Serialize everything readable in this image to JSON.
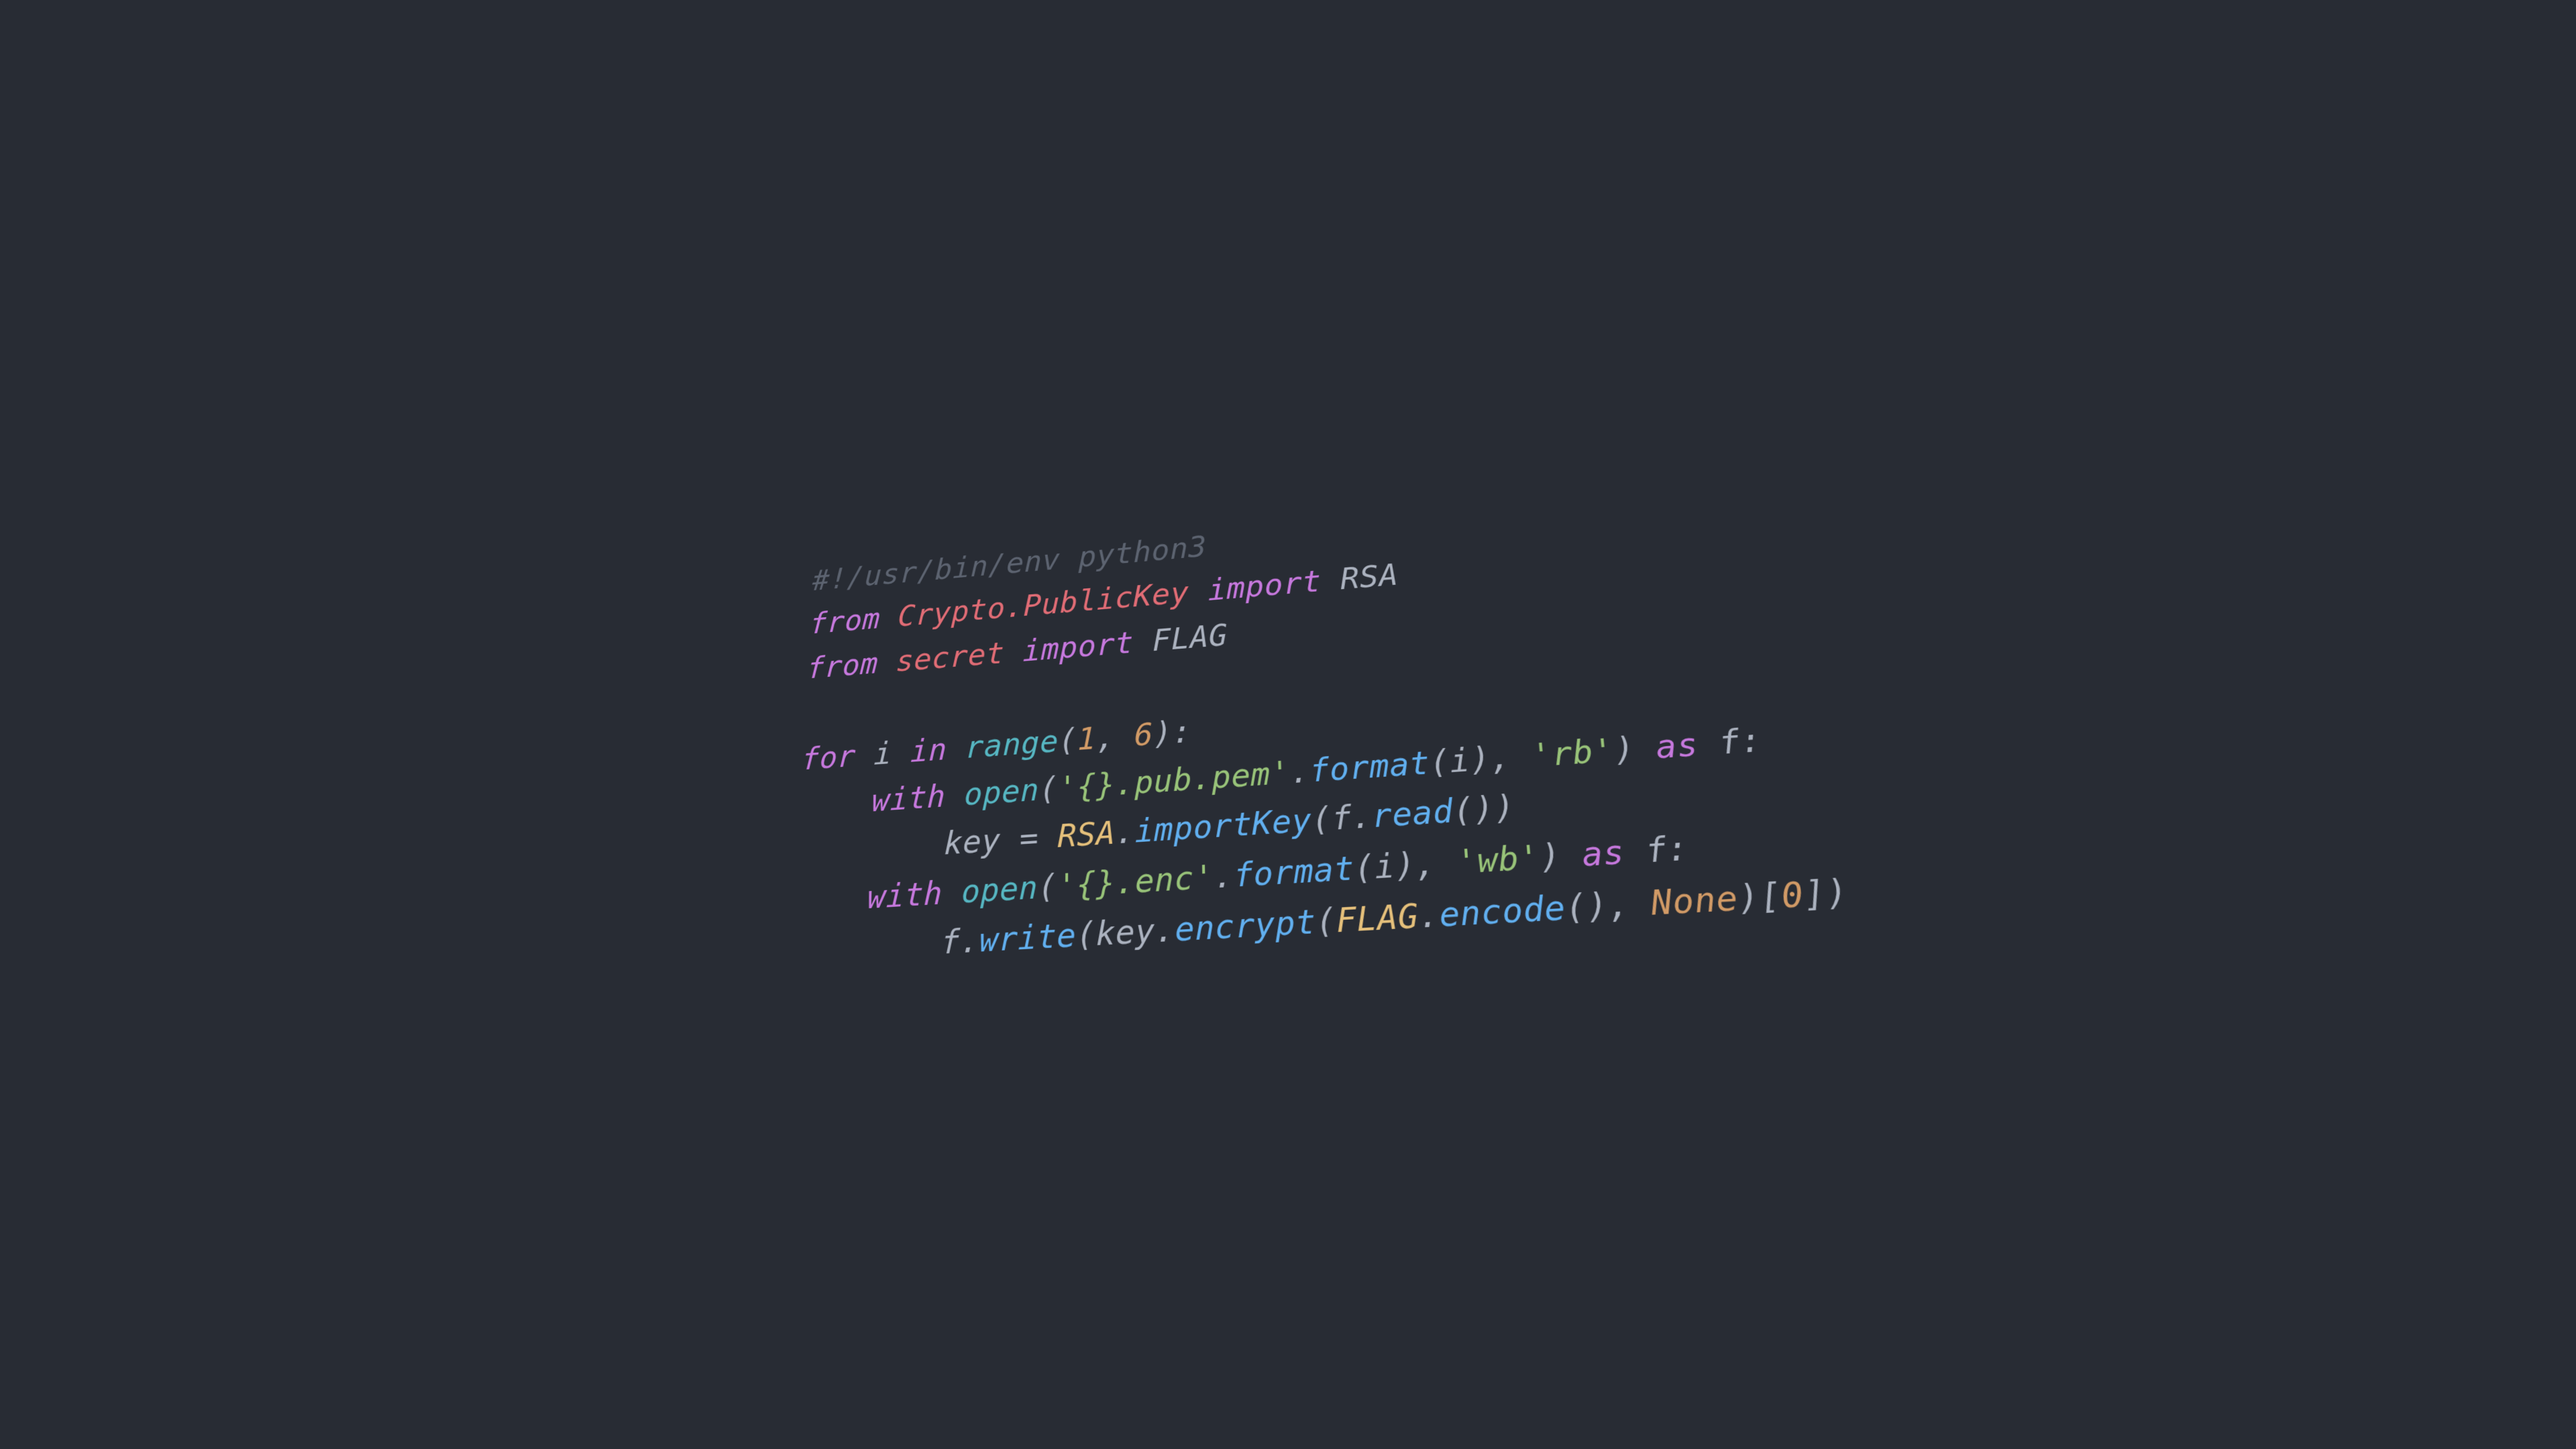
{
  "code": {
    "lines": [
      {
        "indent": 0,
        "tokens": [
          {
            "cls": "tok-comment",
            "text": "#!/usr/bin/env python3"
          }
        ]
      },
      {
        "indent": 0,
        "tokens": [
          {
            "cls": "tok-keyword",
            "text": "from"
          },
          {
            "cls": "tok-ident",
            "text": " "
          },
          {
            "cls": "tok-module",
            "text": "Crypto.PublicKey"
          },
          {
            "cls": "tok-ident",
            "text": " "
          },
          {
            "cls": "tok-keyword",
            "text": "import"
          },
          {
            "cls": "tok-ident",
            "text": " "
          },
          {
            "cls": "tok-ident",
            "text": "RSA"
          }
        ]
      },
      {
        "indent": 0,
        "tokens": [
          {
            "cls": "tok-keyword",
            "text": "from"
          },
          {
            "cls": "tok-ident",
            "text": " "
          },
          {
            "cls": "tok-module",
            "text": "secret"
          },
          {
            "cls": "tok-ident",
            "text": " "
          },
          {
            "cls": "tok-keyword",
            "text": "import"
          },
          {
            "cls": "tok-ident",
            "text": " "
          },
          {
            "cls": "tok-ident",
            "text": "FLAG"
          }
        ]
      },
      {
        "indent": 0,
        "tokens": []
      },
      {
        "indent": 0,
        "tokens": [
          {
            "cls": "tok-keyword",
            "text": "for"
          },
          {
            "cls": "tok-ident",
            "text": " i "
          },
          {
            "cls": "tok-keyword",
            "text": "in"
          },
          {
            "cls": "tok-ident",
            "text": " "
          },
          {
            "cls": "tok-builtin",
            "text": "range"
          },
          {
            "cls": "tok-punct",
            "text": "("
          },
          {
            "cls": "tok-num",
            "text": "1"
          },
          {
            "cls": "tok-punct",
            "text": ", "
          },
          {
            "cls": "tok-num",
            "text": "6"
          },
          {
            "cls": "tok-punct",
            "text": "):"
          }
        ]
      },
      {
        "indent": 1,
        "tokens": [
          {
            "cls": "tok-keyword",
            "text": "with"
          },
          {
            "cls": "tok-ident",
            "text": " "
          },
          {
            "cls": "tok-builtin",
            "text": "open"
          },
          {
            "cls": "tok-punct",
            "text": "("
          },
          {
            "cls": "tok-str",
            "text": "'{}.pub.pem'"
          },
          {
            "cls": "tok-punct",
            "text": "."
          },
          {
            "cls": "tok-func",
            "text": "format"
          },
          {
            "cls": "tok-punct",
            "text": "(i), "
          },
          {
            "cls": "tok-str",
            "text": "'rb'"
          },
          {
            "cls": "tok-punct",
            "text": ") "
          },
          {
            "cls": "tok-keyword",
            "text": "as"
          },
          {
            "cls": "tok-ident",
            "text": " f"
          },
          {
            "cls": "tok-punct",
            "text": ":"
          }
        ]
      },
      {
        "indent": 2,
        "tokens": [
          {
            "cls": "tok-ident",
            "text": "key "
          },
          {
            "cls": "tok-op",
            "text": "="
          },
          {
            "cls": "tok-ident",
            "text": " "
          },
          {
            "cls": "tok-class",
            "text": "RSA"
          },
          {
            "cls": "tok-punct",
            "text": "."
          },
          {
            "cls": "tok-func",
            "text": "importKey"
          },
          {
            "cls": "tok-punct",
            "text": "(f."
          },
          {
            "cls": "tok-func",
            "text": "read"
          },
          {
            "cls": "tok-punct",
            "text": "())"
          }
        ]
      },
      {
        "indent": 1,
        "tokens": [
          {
            "cls": "tok-keyword",
            "text": "with"
          },
          {
            "cls": "tok-ident",
            "text": " "
          },
          {
            "cls": "tok-builtin",
            "text": "open"
          },
          {
            "cls": "tok-punct",
            "text": "("
          },
          {
            "cls": "tok-str",
            "text": "'{}.enc'"
          },
          {
            "cls": "tok-punct",
            "text": "."
          },
          {
            "cls": "tok-func",
            "text": "format"
          },
          {
            "cls": "tok-punct",
            "text": "(i), "
          },
          {
            "cls": "tok-str",
            "text": "'wb'"
          },
          {
            "cls": "tok-punct",
            "text": ") "
          },
          {
            "cls": "tok-keyword",
            "text": "as"
          },
          {
            "cls": "tok-ident",
            "text": " f"
          },
          {
            "cls": "tok-punct",
            "text": ":"
          }
        ]
      },
      {
        "indent": 2,
        "tokens": [
          {
            "cls": "tok-ident",
            "text": "f"
          },
          {
            "cls": "tok-punct",
            "text": "."
          },
          {
            "cls": "tok-func",
            "text": "write"
          },
          {
            "cls": "tok-punct",
            "text": "(key."
          },
          {
            "cls": "tok-func",
            "text": "encrypt"
          },
          {
            "cls": "tok-punct",
            "text": "("
          },
          {
            "cls": "tok-class",
            "text": "FLAG"
          },
          {
            "cls": "tok-punct",
            "text": "."
          },
          {
            "cls": "tok-func",
            "text": "encode"
          },
          {
            "cls": "tok-punct",
            "text": "(), "
          },
          {
            "cls": "tok-const",
            "text": "None"
          },
          {
            "cls": "tok-punct",
            "text": ")["
          },
          {
            "cls": "tok-num",
            "text": "0"
          },
          {
            "cls": "tok-punct",
            "text": "])"
          }
        ]
      }
    ],
    "indent_unit": "    "
  },
  "colors": {
    "background": "#282c34",
    "comment": "#5c6370",
    "keyword": "#c678dd",
    "module": "#e06c75",
    "class": "#e5c07b",
    "identifier": "#abb2bf",
    "function": "#61afef",
    "string": "#98c379",
    "number": "#d19a66",
    "constant": "#d19a66",
    "builtin": "#56b6c2"
  }
}
